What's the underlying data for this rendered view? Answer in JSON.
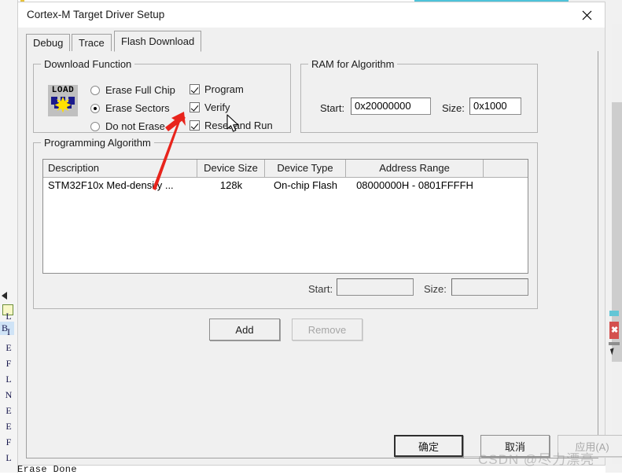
{
  "window": {
    "title": "Cortex-M Target Driver Setup",
    "close_icon": "close-icon"
  },
  "tabs": [
    {
      "label": "Debug",
      "active": false
    },
    {
      "label": "Trace",
      "active": false
    },
    {
      "label": "Flash Download",
      "active": true
    }
  ],
  "download_function": {
    "group_title": "Download Function",
    "icon_text": "LOAD",
    "erase_options": [
      {
        "label": "Erase Full Chip",
        "selected": false
      },
      {
        "label": "Erase Sectors",
        "selected": true
      },
      {
        "label": "Do not Erase",
        "selected": false
      }
    ],
    "checkboxes": [
      {
        "label": "Program",
        "checked": true
      },
      {
        "label": "Verify",
        "checked": true
      },
      {
        "label": "Reset and Run",
        "checked": true
      }
    ]
  },
  "ram_for_algorithm": {
    "group_title": "RAM for Algorithm",
    "start_label": "Start:",
    "start_value": "0x20000000",
    "size_label": "Size:",
    "size_value": "0x1000"
  },
  "programming_algorithm": {
    "group_title": "Programming Algorithm",
    "columns": [
      "Description",
      "Device Size",
      "Device Type",
      "Address Range",
      ""
    ],
    "rows": [
      {
        "description": "STM32F10x Med-density ...",
        "device_size": "128k",
        "device_type": "On-chip Flash",
        "address_range": "08000000H - 0801FFFFH",
        "extra": ""
      }
    ],
    "start_label": "Start:",
    "start_value": "",
    "size_label": "Size:",
    "size_value": ""
  },
  "action_buttons": {
    "add": "Add",
    "remove": "Remove"
  },
  "dialog_buttons": {
    "ok": "确定",
    "cancel": "取消",
    "apply": "应用(A)"
  },
  "background": {
    "status_text": "Erase Done",
    "left_letters": [
      "L",
      "I",
      "E",
      "F",
      "L",
      "N",
      "E",
      "E",
      "F",
      "L"
    ],
    "left_selected_letter": "B",
    "right_badge": "✖"
  },
  "watermark": {
    "text": "CSDN @尽力漂亮"
  },
  "colors": {
    "dialog_bg": "#f0f0f0",
    "titlebar_bg": "#ffffff",
    "accent_cyan": "#4ec3d9",
    "annotation_red": "#e8241c",
    "group_border": "#b4b4b4"
  }
}
